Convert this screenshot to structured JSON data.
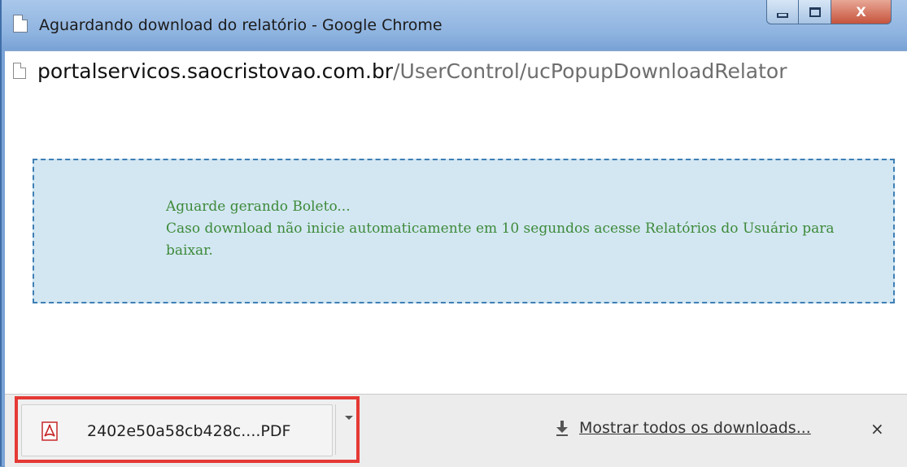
{
  "window": {
    "title": "Aguardando download do relatório - Google Chrome",
    "close_glyph": "X",
    "icons": [
      "document-icon",
      "minimize-icon",
      "maximize-icon",
      "close-icon"
    ]
  },
  "address_bar": {
    "host": "portalservicos.saocristovao.com.br",
    "path": "/UserControl/ucPopupDownloadRelator"
  },
  "notice": {
    "line1": "Aguarde gerando Boleto...",
    "line2": "Caso download não inicie automaticamente em 10 segundos acesse Relatórios do Usuário para baixar."
  },
  "download_bar": {
    "item_filename": "2402e50a58cb428c....PDF",
    "show_all_label": "Mostrar todos os downloads...",
    "close_glyph": "×",
    "icons": [
      "pdf-icon",
      "chevron-down-icon",
      "download-icon",
      "close-icon"
    ],
    "colors": {
      "highlight_border": "#e53935",
      "pdf_red": "#c62828"
    }
  }
}
